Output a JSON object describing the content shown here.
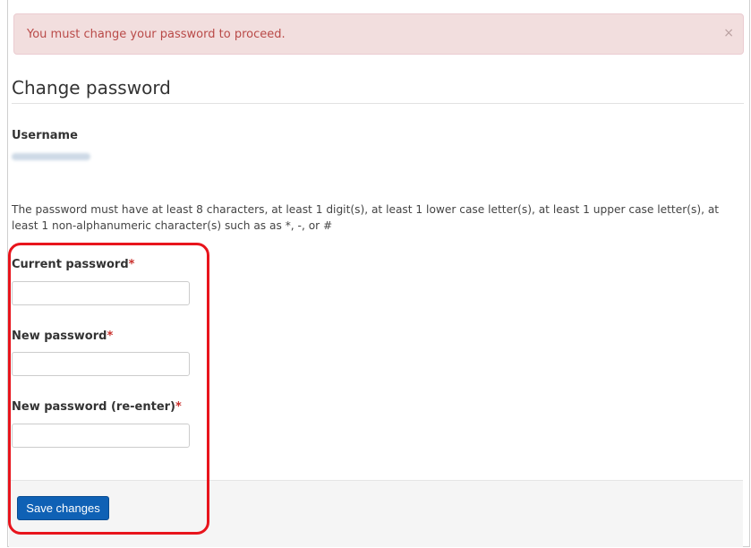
{
  "alert": {
    "message": "You must change your password to proceed.",
    "close_symbol": "×",
    "close_icon": "close-icon"
  },
  "page": {
    "title": "Change password"
  },
  "username": {
    "label": "Username",
    "value": "aprmumo_uo5"
  },
  "policy_text": "The password must have at least 8 characters, at least 1 digit(s), at least 1 lower case letter(s), at least 1 upper case letter(s), at least 1 non-alphanumeric character(s) such as as *, -, or #",
  "form": {
    "required_marker": "*",
    "fields": [
      {
        "label": "Current password",
        "value": ""
      },
      {
        "label": "New password",
        "value": ""
      },
      {
        "label": "New password (re-enter)",
        "value": ""
      }
    ],
    "save_label": "Save changes"
  },
  "colors": {
    "alert_bg": "#f2dede",
    "alert_text": "#b94a48",
    "required": "#c9302c",
    "primary_button": "#0f61b5",
    "highlight_annotation": "#e8141c"
  }
}
